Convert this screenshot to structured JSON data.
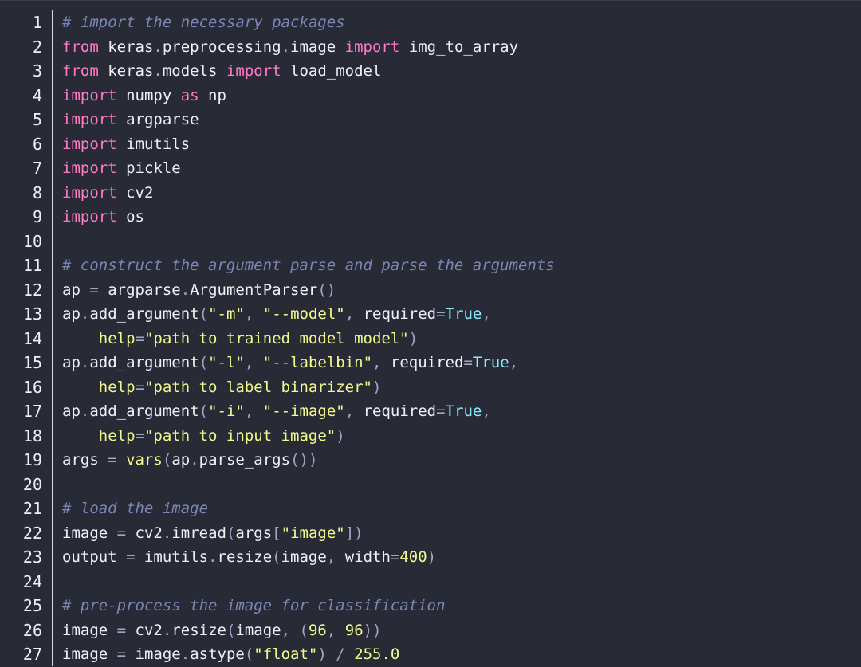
{
  "colors": {
    "background": "#282a36",
    "line_number": "#f0f0f0",
    "divider": "#d6d8de",
    "comment": "#7c86b6",
    "keyword": "#ff79c6",
    "string": "#f1fa8c",
    "constant": "#8be9fd",
    "text": "#f0f1f4"
  },
  "editor": {
    "lines": [
      {
        "n": "1",
        "tokens": [
          [
            "comment",
            "# import the necessary packages"
          ]
        ]
      },
      {
        "n": "2",
        "tokens": [
          [
            "keyword",
            "from"
          ],
          [
            "text",
            " keras"
          ],
          [
            "punct",
            "."
          ],
          [
            "text",
            "preprocessing"
          ],
          [
            "punct",
            "."
          ],
          [
            "text",
            "image "
          ],
          [
            "keyword",
            "import"
          ],
          [
            "text",
            " img_to_array"
          ]
        ]
      },
      {
        "n": "3",
        "tokens": [
          [
            "keyword",
            "from"
          ],
          [
            "text",
            " keras"
          ],
          [
            "punct",
            "."
          ],
          [
            "text",
            "models "
          ],
          [
            "keyword",
            "import"
          ],
          [
            "text",
            " load_model"
          ]
        ]
      },
      {
        "n": "4",
        "tokens": [
          [
            "keyword",
            "import"
          ],
          [
            "text",
            " numpy "
          ],
          [
            "keyword",
            "as"
          ],
          [
            "text",
            " np"
          ]
        ]
      },
      {
        "n": "5",
        "tokens": [
          [
            "keyword",
            "import"
          ],
          [
            "text",
            " argparse"
          ]
        ]
      },
      {
        "n": "6",
        "tokens": [
          [
            "keyword",
            "import"
          ],
          [
            "text",
            " imutils"
          ]
        ]
      },
      {
        "n": "7",
        "tokens": [
          [
            "keyword",
            "import"
          ],
          [
            "text",
            " pickle"
          ]
        ]
      },
      {
        "n": "8",
        "tokens": [
          [
            "keyword",
            "import"
          ],
          [
            "text",
            " cv2"
          ]
        ]
      },
      {
        "n": "9",
        "tokens": [
          [
            "keyword",
            "import"
          ],
          [
            "text",
            " os"
          ]
        ]
      },
      {
        "n": "10",
        "tokens": []
      },
      {
        "n": "11",
        "tokens": [
          [
            "comment",
            "# construct the argument parse and parse the arguments"
          ]
        ]
      },
      {
        "n": "12",
        "tokens": [
          [
            "text",
            "ap "
          ],
          [
            "op",
            "="
          ],
          [
            "text",
            " argparse"
          ],
          [
            "punct",
            "."
          ],
          [
            "text",
            "ArgumentParser"
          ],
          [
            "punct",
            "()"
          ]
        ]
      },
      {
        "n": "13",
        "tokens": [
          [
            "text",
            "ap"
          ],
          [
            "punct",
            "."
          ],
          [
            "text",
            "add_argument"
          ],
          [
            "punct",
            "("
          ],
          [
            "string",
            "\"-m\""
          ],
          [
            "punct",
            ","
          ],
          [
            "text",
            " "
          ],
          [
            "string",
            "\"--model\""
          ],
          [
            "punct",
            ","
          ],
          [
            "text",
            " required"
          ],
          [
            "op",
            "="
          ],
          [
            "const",
            "True"
          ],
          [
            "punct",
            ","
          ]
        ]
      },
      {
        "n": "14",
        "tokens": [
          [
            "text",
            "    "
          ],
          [
            "arg",
            "help"
          ],
          [
            "op",
            "="
          ],
          [
            "string",
            "\"path to trained model model\""
          ],
          [
            "punct",
            ")"
          ]
        ]
      },
      {
        "n": "15",
        "tokens": [
          [
            "text",
            "ap"
          ],
          [
            "punct",
            "."
          ],
          [
            "text",
            "add_argument"
          ],
          [
            "punct",
            "("
          ],
          [
            "string",
            "\"-l\""
          ],
          [
            "punct",
            ","
          ],
          [
            "text",
            " "
          ],
          [
            "string",
            "\"--labelbin\""
          ],
          [
            "punct",
            ","
          ],
          [
            "text",
            " required"
          ],
          [
            "op",
            "="
          ],
          [
            "const",
            "True"
          ],
          [
            "punct",
            ","
          ]
        ]
      },
      {
        "n": "16",
        "tokens": [
          [
            "text",
            "    "
          ],
          [
            "arg",
            "help"
          ],
          [
            "op",
            "="
          ],
          [
            "string",
            "\"path to label binarizer\""
          ],
          [
            "punct",
            ")"
          ]
        ]
      },
      {
        "n": "17",
        "tokens": [
          [
            "text",
            "ap"
          ],
          [
            "punct",
            "."
          ],
          [
            "text",
            "add_argument"
          ],
          [
            "punct",
            "("
          ],
          [
            "string",
            "\"-i\""
          ],
          [
            "punct",
            ","
          ],
          [
            "text",
            " "
          ],
          [
            "string",
            "\"--image\""
          ],
          [
            "punct",
            ","
          ],
          [
            "text",
            " required"
          ],
          [
            "op",
            "="
          ],
          [
            "const",
            "True"
          ],
          [
            "punct",
            ","
          ]
        ]
      },
      {
        "n": "18",
        "tokens": [
          [
            "text",
            "    "
          ],
          [
            "arg",
            "help"
          ],
          [
            "op",
            "="
          ],
          [
            "string",
            "\"path to input image\""
          ],
          [
            "punct",
            ")"
          ]
        ]
      },
      {
        "n": "19",
        "tokens": [
          [
            "text",
            "args "
          ],
          [
            "op",
            "="
          ],
          [
            "text",
            " "
          ],
          [
            "builtin",
            "vars"
          ],
          [
            "punct",
            "("
          ],
          [
            "text",
            "ap"
          ],
          [
            "punct",
            "."
          ],
          [
            "text",
            "parse_args"
          ],
          [
            "punct",
            "())"
          ]
        ]
      },
      {
        "n": "20",
        "tokens": []
      },
      {
        "n": "21",
        "tokens": [
          [
            "comment",
            "# load the image"
          ]
        ]
      },
      {
        "n": "22",
        "tokens": [
          [
            "text",
            "image "
          ],
          [
            "op",
            "="
          ],
          [
            "text",
            " cv2"
          ],
          [
            "punct",
            "."
          ],
          [
            "text",
            "imread"
          ],
          [
            "punct",
            "("
          ],
          [
            "text",
            "args"
          ],
          [
            "punct",
            "["
          ],
          [
            "string",
            "\"image\""
          ],
          [
            "punct",
            "])"
          ]
        ]
      },
      {
        "n": "23",
        "tokens": [
          [
            "text",
            "output "
          ],
          [
            "op",
            "="
          ],
          [
            "text",
            " imutils"
          ],
          [
            "punct",
            "."
          ],
          [
            "text",
            "resize"
          ],
          [
            "punct",
            "("
          ],
          [
            "text",
            "image"
          ],
          [
            "punct",
            ","
          ],
          [
            "text",
            " width"
          ],
          [
            "op",
            "="
          ],
          [
            "number",
            "400"
          ],
          [
            "punct",
            ")"
          ]
        ]
      },
      {
        "n": "24",
        "tokens": []
      },
      {
        "n": "25",
        "tokens": [
          [
            "comment",
            "# pre-process the image for classification"
          ]
        ]
      },
      {
        "n": "26",
        "tokens": [
          [
            "text",
            "image "
          ],
          [
            "op",
            "="
          ],
          [
            "text",
            " cv2"
          ],
          [
            "punct",
            "."
          ],
          [
            "text",
            "resize"
          ],
          [
            "punct",
            "("
          ],
          [
            "text",
            "image"
          ],
          [
            "punct",
            ","
          ],
          [
            "text",
            " "
          ],
          [
            "punct",
            "("
          ],
          [
            "number",
            "96"
          ],
          [
            "punct",
            ","
          ],
          [
            "text",
            " "
          ],
          [
            "number",
            "96"
          ],
          [
            "punct",
            "))"
          ]
        ]
      },
      {
        "n": "27",
        "tokens": [
          [
            "text",
            "image "
          ],
          [
            "op",
            "="
          ],
          [
            "text",
            " image"
          ],
          [
            "punct",
            "."
          ],
          [
            "text",
            "astype"
          ],
          [
            "punct",
            "("
          ],
          [
            "string",
            "\"float\""
          ],
          [
            "punct",
            ")"
          ],
          [
            "text",
            " "
          ],
          [
            "op",
            "/"
          ],
          [
            "text",
            " "
          ],
          [
            "number",
            "255.0"
          ]
        ]
      }
    ]
  }
}
